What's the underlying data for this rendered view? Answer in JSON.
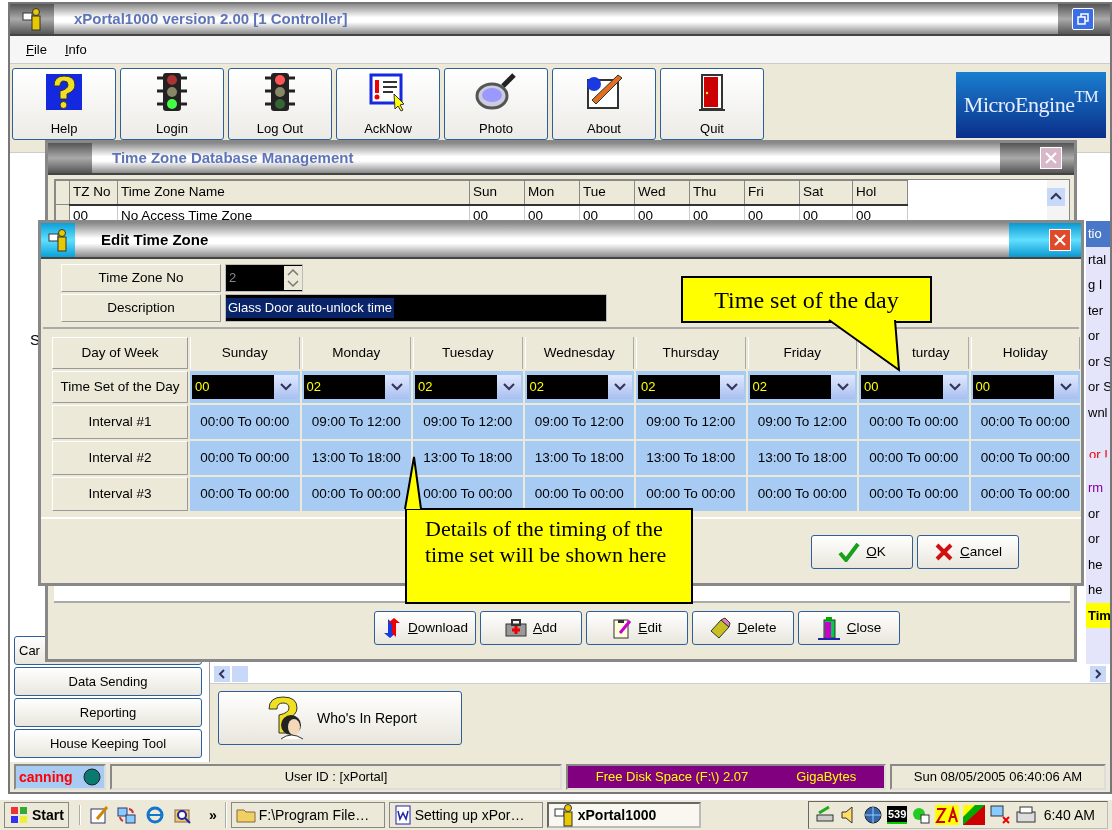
{
  "main_window": {
    "title": "xPortal1000 version 2.00 [1 Controller]"
  },
  "menu": [
    "File",
    "Info"
  ],
  "toolbar": [
    {
      "label": "Help",
      "kind": "help"
    },
    {
      "label": "Login",
      "kind": "login"
    },
    {
      "label": "Log Out",
      "kind": "logout"
    },
    {
      "label": "AckNow",
      "kind": "ack"
    },
    {
      "label": "Photo",
      "kind": "photo"
    },
    {
      "label": "About",
      "kind": "about"
    },
    {
      "label": "Quit",
      "kind": "quit"
    }
  ],
  "logo": "MicroEngine$^{TM}$",
  "left_fragment": "S",
  "left_nav": [
    "Car",
    "Data Sending",
    "Reporting",
    "House Keeping Tool"
  ],
  "right_fragments": [
    {
      "text": "tio",
      "kind": "header"
    },
    {
      "text": "rtal",
      "kind": "plain"
    },
    {
      "text": "g I",
      "kind": "plain"
    },
    {
      "text": "ter",
      "kind": "plain"
    },
    {
      "text": "or",
      "kind": "plain"
    },
    {
      "text": "or S",
      "kind": "plain"
    },
    {
      "text": "or S",
      "kind": "plain"
    },
    {
      "text": "wnl",
      "kind": "plain"
    },
    {
      "text": "or I",
      "kind": "alert"
    },
    {
      "text": "rm",
      "kind": "alarm"
    },
    {
      "text": "or",
      "kind": "plain"
    },
    {
      "text": "or",
      "kind": "plain"
    },
    {
      "text": "he",
      "kind": "plain"
    },
    {
      "text": "he",
      "kind": "plain"
    },
    {
      "text": "Tim",
      "kind": "highlight"
    }
  ],
  "report_button": "Who's In Report",
  "status_bar": {
    "scan": "canning",
    "user": "User ID : [xPortal]",
    "disk": "Free Disk Space (F:\\) 2.07",
    "disk_unit": "GigaBytes",
    "datetime": "Sun 08/05/2005 06:40:06 AM"
  },
  "db_window": {
    "title": "Time Zone Database Management",
    "columns": [
      "TZ No",
      "Time Zone Name",
      "Sun",
      "Mon",
      "Tue",
      "Wed",
      "Thu",
      "Fri",
      "Sat",
      "Hol"
    ],
    "rows": [
      [
        "00",
        "No Access Time Zone",
        "00",
        "00",
        "00",
        "00",
        "00",
        "00",
        "00",
        "00"
      ]
    ],
    "buttons": [
      {
        "label": "Download",
        "kind": "download"
      },
      {
        "label": "Add",
        "kind": "add"
      },
      {
        "label": "Edit",
        "kind": "edit"
      },
      {
        "label": "Delete",
        "kind": "delete"
      },
      {
        "label": "Close",
        "kind": "close"
      }
    ]
  },
  "edit_dialog": {
    "title": "Edit Time Zone",
    "fields": [
      {
        "label": "Time Zone No",
        "value": "2",
        "kind": "spinner"
      },
      {
        "label": "Description",
        "value": "Glass Door auto-unlock time",
        "kind": "text"
      }
    ],
    "corner": "Day of Week",
    "days": [
      "Sunday",
      "Monday",
      "Tuesday",
      "Wednesday",
      "Thursday",
      "Friday",
      "turday",
      "Holiday"
    ],
    "time_set_label": "Time Set of the Day",
    "time_sets": [
      "00",
      "02",
      "02",
      "02",
      "02",
      "02",
      "00",
      "00"
    ],
    "intervals": [
      {
        "label": "Interval #1",
        "values": [
          "00:00 To 00:00",
          "09:00 To 12:00",
          "09:00 To 12:00",
          "09:00 To 12:00",
          "09:00 To 12:00",
          "09:00 To 12:00",
          "00:00 To 00:00",
          "00:00 To 00:00"
        ]
      },
      {
        "label": "Interval #2",
        "values": [
          "00:00 To 00:00",
          "13:00 To 18:00",
          "13:00 To 18:00",
          "13:00 To 18:00",
          "13:00 To 18:00",
          "13:00 To 18:00",
          "00:00 To 00:00",
          "00:00 To 00:00"
        ]
      },
      {
        "label": "Interval #3",
        "values": [
          "00:00 To 00:00",
          "00:00 To 00:00",
          "00:00 To 00:00",
          "00:00 To 00:00",
          "00:00 To 00:00",
          "00:00 To 00:00",
          "00:00 To 00:00",
          "00:00 To 00:00"
        ]
      }
    ],
    "buttons": [
      {
        "label": "OK",
        "kind": "ok"
      },
      {
        "label": "Cancel",
        "kind": "cancel"
      }
    ]
  },
  "callouts": [
    {
      "text": "Time set of the day",
      "kind": "top"
    },
    {
      "text": "Details of the timing of the time set will be shown here",
      "kind": "bottom"
    }
  ],
  "taskbar": {
    "start": "Start",
    "more": "»",
    "tasks": [
      {
        "label": "F:\\Program File…",
        "kind": "folder",
        "selected": false
      },
      {
        "label": "Setting up xPor…",
        "kind": "document",
        "selected": false
      },
      {
        "label": "xPortal1000",
        "kind": "app",
        "selected": true
      }
    ],
    "tray_counter": "539",
    "clock": "6:40 AM"
  }
}
